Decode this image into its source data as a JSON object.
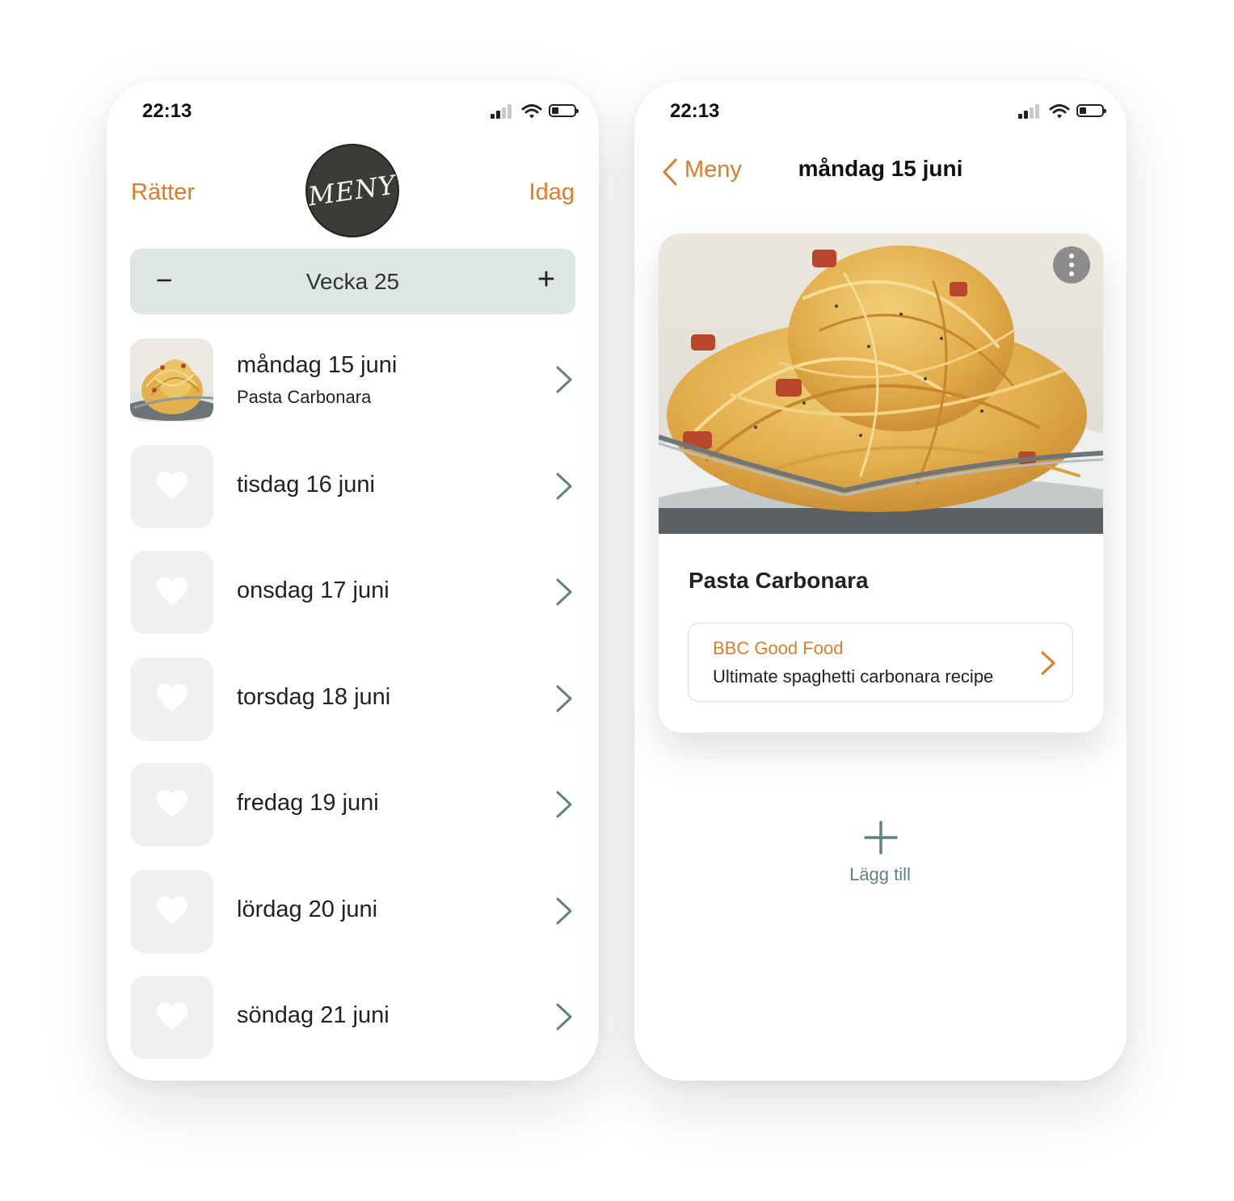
{
  "colors": {
    "accent": "#e07b2a",
    "teal": "#5f8282",
    "week_bar": "#dde5e5",
    "placeholder": "#f0f0f0"
  },
  "left": {
    "status": {
      "time": "22:13"
    },
    "header": {
      "left_label": "Rätter",
      "logo_text": "MENY",
      "right_label": "Idag"
    },
    "week": {
      "minus": "−",
      "label": "Vecka 25",
      "plus": "+"
    },
    "days": [
      {
        "title": "måndag 15 juni",
        "subtitle": "Pasta Carbonara",
        "icon": "pasta-thumbnail"
      },
      {
        "title": "tisdag 16 juni",
        "icon": "heart-icon"
      },
      {
        "title": "onsdag 17 juni",
        "icon": "heart-icon"
      },
      {
        "title": "torsdag 18 juni",
        "icon": "heart-icon"
      },
      {
        "title": "fredag 19 juni",
        "icon": "heart-icon"
      },
      {
        "title": "lördag 20 juni",
        "icon": "heart-icon"
      },
      {
        "title": "söndag 21 juni",
        "icon": "heart-icon"
      }
    ]
  },
  "right": {
    "status": {
      "time": "22:13"
    },
    "nav": {
      "back_label": "Meny",
      "title": "måndag 15 juni"
    },
    "card": {
      "recipe_title": "Pasta Carbonara",
      "source_name": "BBC Good Food",
      "source_description": "Ultimate spaghetti carbonara recipe"
    },
    "add": {
      "label": "Lägg till"
    }
  }
}
